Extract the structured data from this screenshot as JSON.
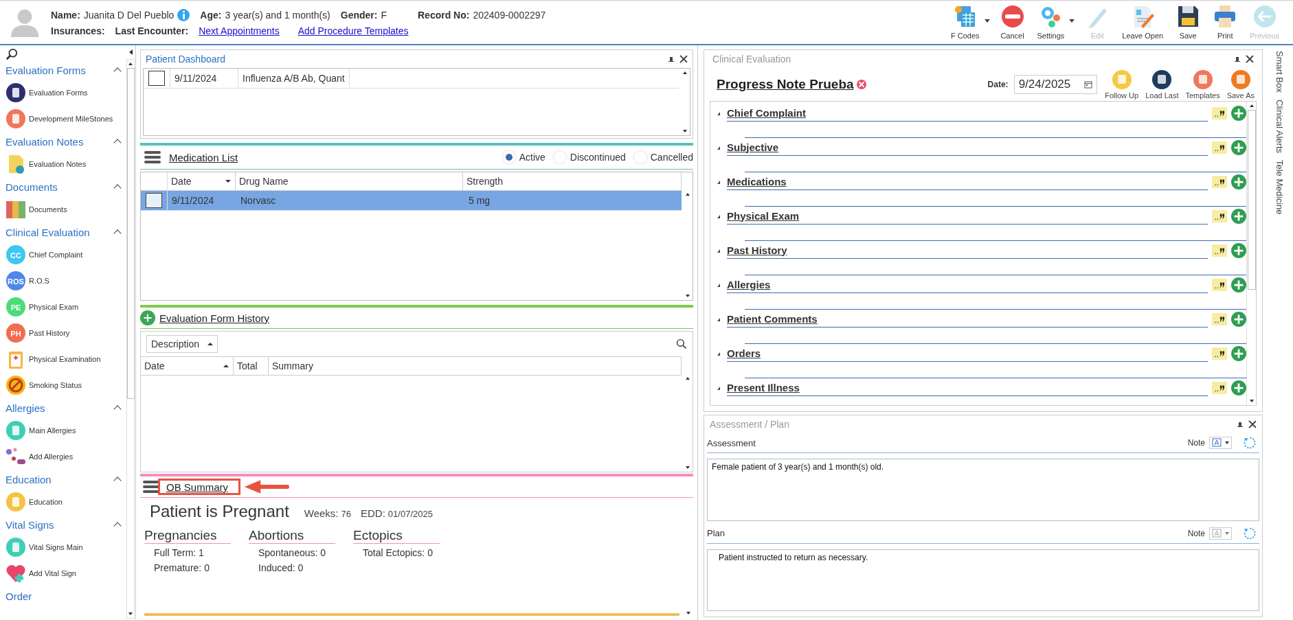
{
  "patient": {
    "name_label": "Name:",
    "name": "Juanita D Del Pueblo",
    "age_label": "Age:",
    "age": "3 year(s) and 1 month(s)",
    "gender_label": "Gender:",
    "gender": "F",
    "record_label": "Record No:",
    "record": "202409-0002297",
    "insurances_label": "Insurances:",
    "last_encounter_label": "Last Encounter:",
    "links": [
      "Next Appointments",
      "Add Procedure Templates"
    ]
  },
  "toolbar": [
    {
      "label": "F Codes",
      "dropdown": true,
      "disabled": false
    },
    {
      "label": "Cancel",
      "dropdown": false,
      "disabled": false
    },
    {
      "label": "Settings",
      "dropdown": true,
      "disabled": false
    },
    {
      "label": "Edit",
      "dropdown": false,
      "disabled": true
    },
    {
      "label": "Leave Open",
      "dropdown": false,
      "disabled": false
    },
    {
      "label": "Save",
      "dropdown": false,
      "disabled": false
    },
    {
      "label": "Print",
      "dropdown": false,
      "disabled": false
    },
    {
      "label": "Previous",
      "dropdown": false,
      "disabled": true
    }
  ],
  "sidebar": {
    "sections": [
      {
        "title": "Evaluation Forms",
        "expanded": true,
        "items": [
          {
            "label": "Evaluation Forms"
          },
          {
            "label": "Development MileStones"
          }
        ]
      },
      {
        "title": "Evaluation Notes",
        "expanded": true,
        "items": [
          {
            "label": "Evaluation Notes"
          }
        ]
      },
      {
        "title": "Documents",
        "expanded": true,
        "items": [
          {
            "label": "Documents"
          }
        ]
      },
      {
        "title": "Clinical Evaluation",
        "expanded": true,
        "items": [
          {
            "label": "Chief Complaint",
            "badge": "CC"
          },
          {
            "label": "R.O.S",
            "badge": "ROS"
          },
          {
            "label": "Physical Exam",
            "badge": "PE"
          },
          {
            "label": "Past History",
            "badge": "PH"
          },
          {
            "label": "Physical Examination"
          },
          {
            "label": "Smoking Status"
          }
        ]
      },
      {
        "title": "Allergies",
        "expanded": true,
        "items": [
          {
            "label": "Main Allergies"
          },
          {
            "label": "Add Allergies"
          }
        ]
      },
      {
        "title": "Education",
        "expanded": true,
        "items": [
          {
            "label": "Education"
          }
        ]
      },
      {
        "title": "Vital Signs",
        "expanded": true,
        "items": [
          {
            "label": "Vital Signs Main"
          },
          {
            "label": "Add Vital Sign"
          }
        ]
      },
      {
        "title": "Order"
      }
    ]
  },
  "dashboard": {
    "title": "Patient Dashboard",
    "rows": [
      {
        "checked": false,
        "date": "9/11/2024",
        "test": "Influenza A/B Ab, Quant"
      }
    ]
  },
  "medication": {
    "title": "Medication List",
    "filters": [
      {
        "label": "Active",
        "selected": true
      },
      {
        "label": "Discontinued",
        "selected": false
      },
      {
        "label": "Cancelled",
        "selected": false
      }
    ],
    "columns": [
      "Date",
      "Drug Name",
      "Strength"
    ],
    "rows": [
      {
        "checked": false,
        "selected": true,
        "cells": [
          "9/11/2024",
          "Norvasc",
          "5 mg"
        ]
      }
    ]
  },
  "history": {
    "title": "Evaluation Form History",
    "group_by": "Description",
    "columns": [
      "Date",
      "Total",
      "Summary"
    ]
  },
  "ob": {
    "title": "OB Summary",
    "status": "Patient is Pregnant",
    "weeks_label": "Weeks:",
    "weeks": "76",
    "edd_label": "EDD:",
    "edd": "01/07/2025",
    "groups": [
      {
        "title": "Pregnancies",
        "lines": [
          "Full Term: 1",
          "Premature: 0"
        ]
      },
      {
        "title": "Abortions",
        "lines": [
          "Spontaneous: 0",
          "Induced: 0"
        ]
      },
      {
        "title": "Ectopics",
        "lines": [
          "Total Ectopics: 0"
        ]
      }
    ]
  },
  "clinical": {
    "title": "Clinical Evaluation",
    "note_title": "Progress Note Prueba",
    "date_label": "Date:",
    "date": "9/24/2025",
    "actions": [
      "Follow Up",
      "Load Last",
      "Templates",
      "Save As"
    ],
    "sections": [
      "Chief Complaint",
      "Subjective",
      "Medications",
      "Physical Exam",
      "Past History",
      "Allergies",
      "Patient Comments",
      "Orders",
      "Present Illness"
    ]
  },
  "assessment": {
    "title": "Assessment / Plan",
    "parts": [
      {
        "label": "Assessment",
        "note_label": "Note",
        "disabled": false,
        "text": "Female patient of 3 year(s) and 1 month(s) old."
      },
      {
        "label": "Plan",
        "note_label": "Note",
        "disabled": true,
        "text": "Patient instructed to return as necessary."
      }
    ]
  },
  "side_tabs": [
    "Smart Box",
    "Clinical Alerts",
    "Tele Medicine"
  ]
}
